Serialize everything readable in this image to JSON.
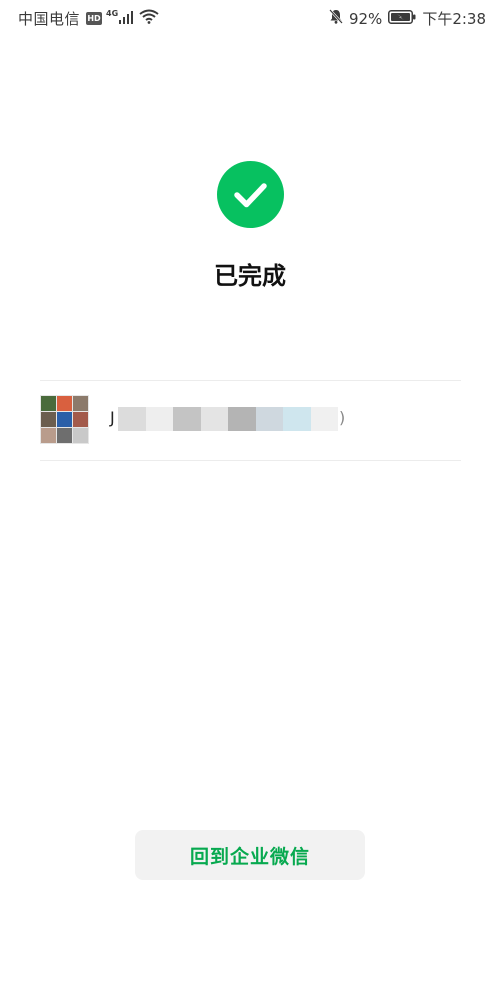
{
  "status_bar": {
    "carrier": "中国电信",
    "hd_badge": "HD",
    "network": "4G",
    "battery_percent": "92%",
    "time": "下午2:38",
    "icons": [
      "signal-icon",
      "wifi-icon",
      "bell-off-icon",
      "battery-charging-icon"
    ]
  },
  "result": {
    "icon": "check-circle-icon",
    "accent_color": "#07c160",
    "title": "已完成"
  },
  "group": {
    "name_visible": "J",
    "name_redacted": true,
    "name_suffix": ")",
    "avatar_colors": [
      "#4a6b3c",
      "#d9603f",
      "#8c7a6b",
      "#6b5e4f",
      "#2a5fa8",
      "#a35a4b",
      "#b99c8c",
      "#6e6e6e",
      "#c9c9c9"
    ]
  },
  "actions": {
    "back_label": "回到企业微信",
    "label_color": "#07a94f"
  }
}
